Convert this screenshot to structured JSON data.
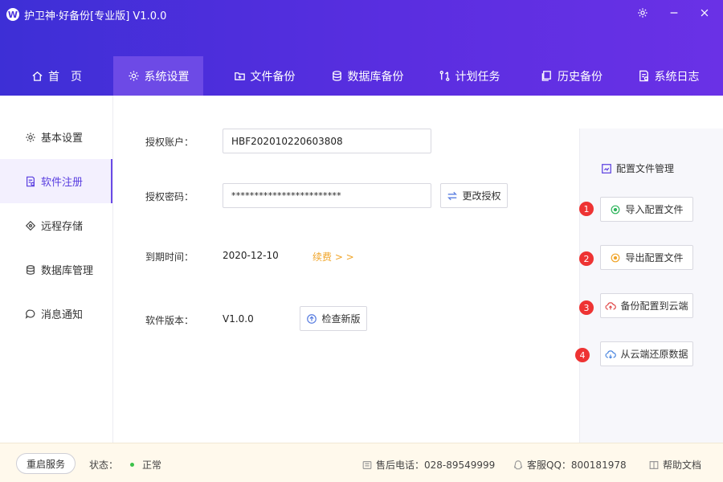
{
  "app": {
    "logo_letter": "W",
    "title": "护卫神·好备份[专业版]  V1.0.0"
  },
  "window_controls": {
    "settings": "gear-icon",
    "minimize": "minus-icon",
    "close": "close-icon"
  },
  "nav": [
    {
      "label": "首　页",
      "icon": "home-icon"
    },
    {
      "label": "系统设置",
      "icon": "gear-icon",
      "active": true
    },
    {
      "label": "文件备份",
      "icon": "folder-plus-icon"
    },
    {
      "label": "数据库备份",
      "icon": "database-icon"
    },
    {
      "label": "计划任务",
      "icon": "task-icon"
    },
    {
      "label": "历史备份",
      "icon": "history-icon"
    },
    {
      "label": "系统日志",
      "icon": "log-icon"
    }
  ],
  "sidebar": [
    {
      "label": "基本设置",
      "icon": "gear-icon"
    },
    {
      "label": "软件注册",
      "icon": "register-icon",
      "active": true
    },
    {
      "label": "远程存储",
      "icon": "remote-icon"
    },
    {
      "label": "数据库管理",
      "icon": "database-icon"
    },
    {
      "label": "消息通知",
      "icon": "message-icon"
    }
  ],
  "form": {
    "account_label": "授权账户：",
    "account_value": "HBF20201022060380­8",
    "password_label": "授权密码：",
    "password_value": "************************",
    "change_auth_button": "更改授权",
    "expire_label": "到期时间：",
    "expire_value": "2020-12-10",
    "renew_link": "续费 > >",
    "version_label": "软件版本：",
    "version_value": "V1.0.0",
    "check_update_button": "检查新版"
  },
  "config_panel": {
    "title": "配置文件管理",
    "actions": [
      {
        "num": "1",
        "label": "导入配置文件",
        "icon": "import-icon"
      },
      {
        "num": "2",
        "label": "导出配置文件",
        "icon": "export-icon"
      },
      {
        "num": "3",
        "label": "备份配置到云端",
        "icon": "cloud-upload-icon"
      },
      {
        "num": "4",
        "label": "从云端还原数据",
        "icon": "cloud-download-icon"
      }
    ]
  },
  "statusbar": {
    "restart_button": "重启服务",
    "status_label": "状态：",
    "status_value": "正常",
    "phone": "售后电话：028-89549999",
    "qq": "客服QQ：800181978",
    "help": "帮助文档"
  },
  "colors": {
    "accent": "#5a3ee0",
    "badge": "#ee3333",
    "link": "#f0a52a",
    "status_ok": "#3cc24a"
  }
}
